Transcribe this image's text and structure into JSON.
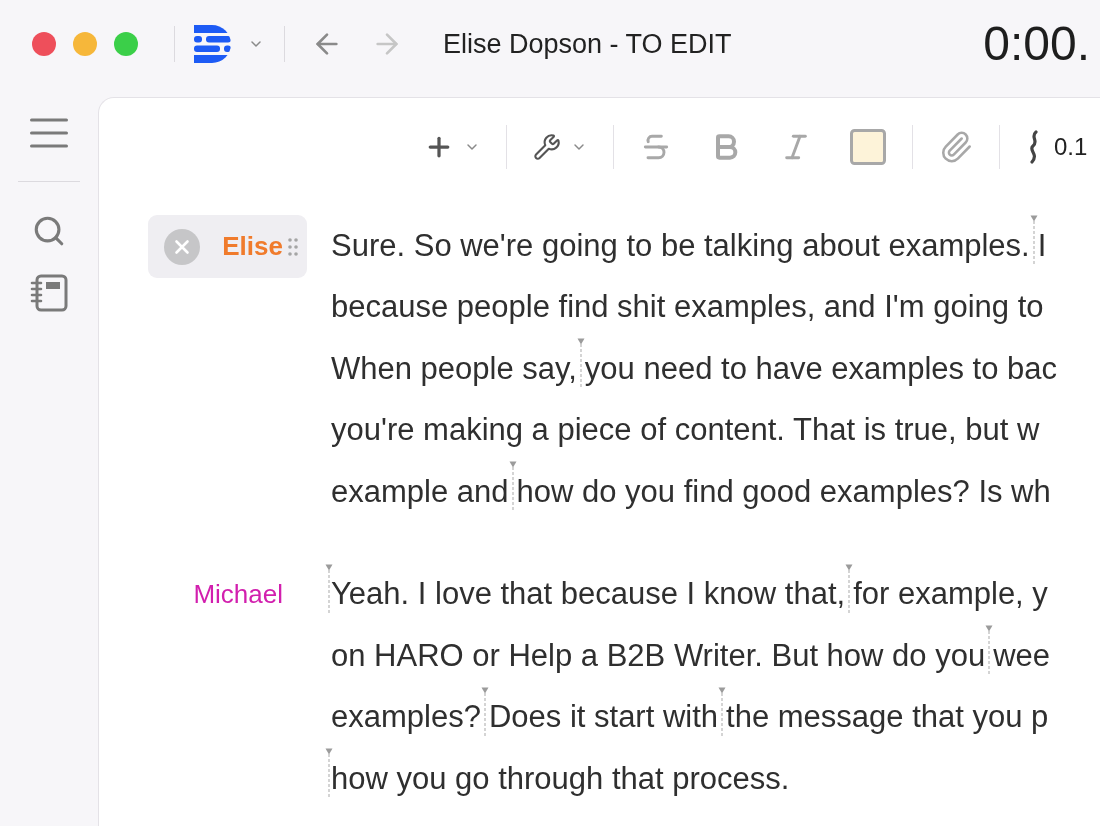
{
  "header": {
    "nav_buttons": [
      {
        "kind": "back",
        "disabled": false
      },
      {
        "kind": "forward",
        "disabled": true
      }
    ],
    "title": "Elise Dopson - TO EDIT",
    "timer": "0:00."
  },
  "editor_toolbar": {
    "groups": [
      [
        {
          "kind": "insert",
          "disabled": false
        }
      ],
      [
        {
          "kind": "tools",
          "disabled": false
        }
      ],
      [
        {
          "kind": "strikethrough",
          "disabled": true
        },
        {
          "kind": "bold",
          "disabled": true
        },
        {
          "kind": "italic",
          "disabled": true
        },
        {
          "kind": "highlight",
          "disabled": true
        }
      ],
      [
        {
          "kind": "attach",
          "disabled": true
        }
      ]
    ],
    "toolbar_value": "0.1"
  },
  "transcript": [
    {
      "speaker": "Elise",
      "color": "#f07b2c",
      "selected": true,
      "lines": [
        {
          "segments": [
            {
              "text": "Sure. So we're going to be talking about examples.",
              "marker": false
            },
            {
              "text": "I",
              "marker": true
            }
          ]
        },
        {
          "segments": [
            {
              "text": "because people find shit examples, and I'm going to",
              "marker": false
            }
          ]
        },
        {
          "segments": [
            {
              "text": "When people say,",
              "marker": false
            },
            {
              "text": "you need to have examples to bac",
              "marker": true
            }
          ]
        },
        {
          "segments": [
            {
              "text": "you're making a piece of content. That is true, but w",
              "marker": false
            }
          ]
        },
        {
          "segments": [
            {
              "text": "example and",
              "marker": false
            },
            {
              "text": "how do you find good examples? Is wh",
              "marker": true
            }
          ]
        }
      ]
    },
    {
      "speaker": "Michael",
      "color": "#d21fae",
      "selected": false,
      "lines": [
        {
          "segments": [
            {
              "text": "Yeah. I love that because I know that,",
              "marker": true
            },
            {
              "text": "for example, y",
              "marker": true
            }
          ]
        },
        {
          "segments": [
            {
              "text": "on HARO or Help a B2B Writer. But how do you",
              "marker": false
            },
            {
              "text": "wee",
              "marker": true
            }
          ]
        },
        {
          "segments": [
            {
              "text": "examples?",
              "marker": false
            },
            {
              "text": "Does it start with",
              "marker": true
            },
            {
              "text": "the message that you p",
              "marker": true
            }
          ]
        },
        {
          "segments": [
            {
              "text": "how you go through that process.",
              "marker": true
            }
          ]
        }
      ]
    }
  ]
}
